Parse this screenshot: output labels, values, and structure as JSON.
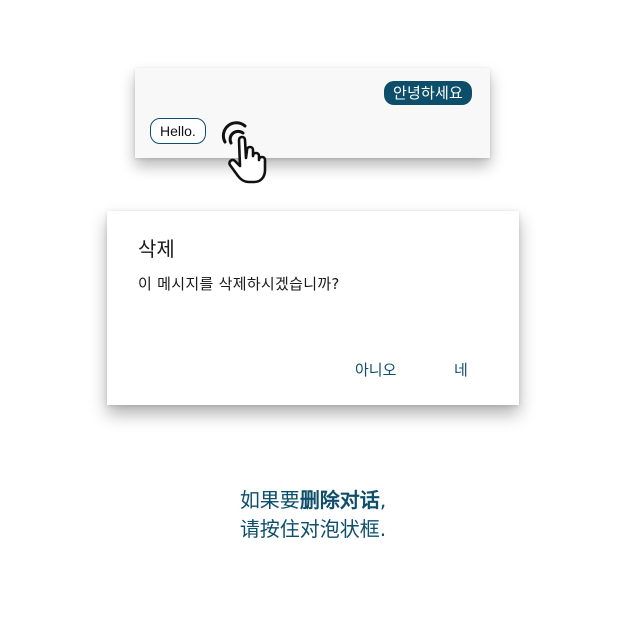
{
  "chat": {
    "sent_message": "안녕하세요",
    "received_message": "Hello."
  },
  "icons": {
    "hand": "hand-tap-long-press-icon"
  },
  "dialog": {
    "title": "삭제",
    "message": "이 메시지를 삭제하시겠습니까?",
    "no_label": "아니오",
    "yes_label": "네"
  },
  "caption": {
    "line1_prefix": "如果要",
    "line1_emphasis": "删除对话",
    "line1_suffix": ",",
    "line2": "请按住对泡状框."
  },
  "colors": {
    "accent": "#0d4f6b",
    "card_background": "#f8f8f8"
  }
}
